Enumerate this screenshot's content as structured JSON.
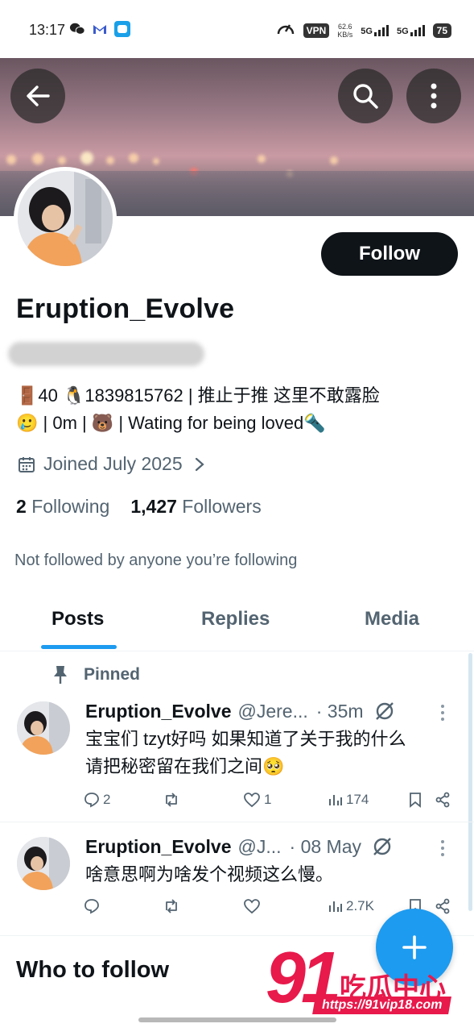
{
  "status_bar": {
    "time": "13:17",
    "vpn": "VPN",
    "net_speed": "62.6",
    "net_unit": "KB/s",
    "sig1": "5G",
    "sig2": "5G",
    "battery": "75"
  },
  "profile": {
    "follow_label": "Follow",
    "display_name": "Eruption_Evolve",
    "bio_line1": "🚪40 🐧1839815762 | 推止于推 这里不敢露脸",
    "bio_line2": "🥲 | 0m | 🐻 | Wating for being loved🔦",
    "joined": "Joined July 2025",
    "following_count": "2",
    "following_label": "Following",
    "followers_count": "1,427",
    "followers_label": "Followers",
    "not_followed": "Not followed by anyone you’re following"
  },
  "tabs": [
    {
      "label": "Posts",
      "active": true
    },
    {
      "label": "Replies",
      "active": false
    },
    {
      "label": "Media",
      "active": false
    }
  ],
  "pinned_label": "Pinned",
  "posts": [
    {
      "name": "Eruption_Evolve",
      "handle": "@Jere...",
      "time": "· 35m",
      "text_line1": "宝宝们 tzyt好吗 如果知道了关于我的什么",
      "text_line2": "请把秘密留在我们之间🥺",
      "replies": "2",
      "likes": "1",
      "views": "174"
    },
    {
      "name": "Eruption_Evolve",
      "handle": "@J...",
      "time": "· 08 May",
      "text_line1": "啥意思啊为啥发个视频这么慢。",
      "replies": "",
      "likes": "",
      "views": "2.7K"
    }
  ],
  "who_to_follow": "Who to follow",
  "watermark": {
    "number": "91",
    "chinese": "吃瓜中心",
    "url": "https://91vip18.com"
  },
  "colors": {
    "accent": "#1d9bf0",
    "text": "#0f1419",
    "muted": "#536471",
    "watermark": "#e8194b"
  }
}
